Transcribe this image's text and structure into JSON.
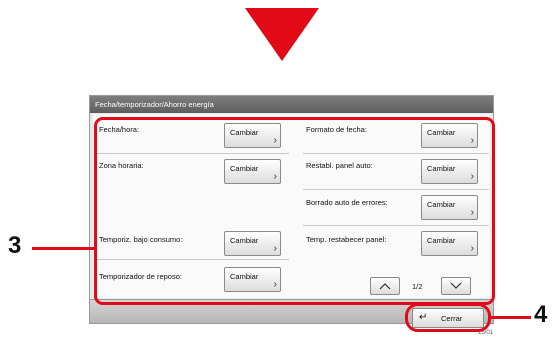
{
  "panel": {
    "title": "Fecha/temporizador/Ahorro energía"
  },
  "settings": [
    {
      "label": "Fecha/hora:",
      "button": "Cambiar"
    },
    {
      "label": "Formato de fecha:",
      "button": "Cambiar"
    },
    {
      "label": "Zona horaria:",
      "button": "Cambiar"
    },
    {
      "label": "Restabl. panel auto:",
      "button": "Cambiar"
    },
    {
      "label": "Borrado auto de errores:",
      "button": "Cambiar"
    },
    {
      "label": "Temporiz. bajo consumo:",
      "button": "Cambiar"
    },
    {
      "label": "Temp. restabecer panel:",
      "button": "Cambiar"
    },
    {
      "label": "Temporizador de reposo:",
      "button": "Cambiar"
    }
  ],
  "pagination": {
    "page": "1/2"
  },
  "footer": {
    "close_label": "Cerrar",
    "tiny": "15/01"
  },
  "callouts": {
    "settings_number": "3",
    "close_number": "4"
  },
  "icons": {
    "arrow": "down-arrow-icon",
    "prev": "chevron-up-icon",
    "next": "chevron-down-icon",
    "close": "return-icon"
  },
  "colors": {
    "accent": "#e20a16"
  }
}
